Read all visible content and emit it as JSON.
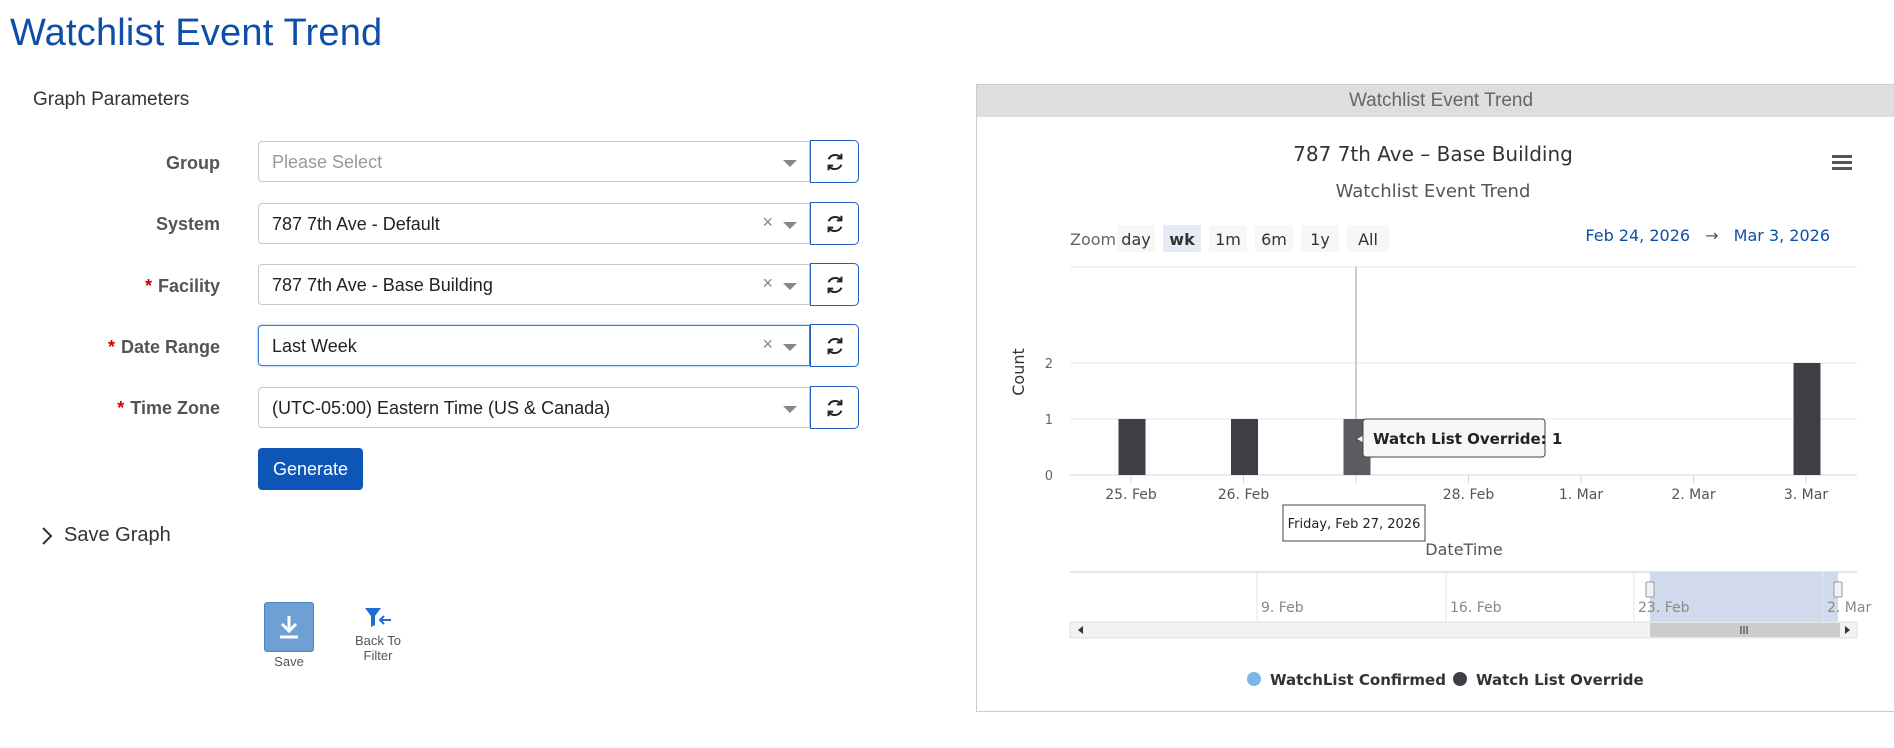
{
  "page": {
    "title": "Watchlist Event Trend"
  },
  "params": {
    "section_title": "Graph Parameters",
    "fields": [
      {
        "label": "Group",
        "required": false,
        "value": "Please Select",
        "placeholder": true,
        "clearable": false
      },
      {
        "label": "System",
        "required": false,
        "value": "787 7th Ave - Default",
        "placeholder": false,
        "clearable": true
      },
      {
        "label": "Facility",
        "required": true,
        "value": "787 7th Ave - Base Building",
        "placeholder": false,
        "clearable": true
      },
      {
        "label": "Date Range",
        "required": true,
        "value": "Last Week",
        "placeholder": false,
        "clearable": true
      },
      {
        "label": "Time Zone",
        "required": true,
        "value": "(UTC-05:00) Eastern Time (US & Canada)",
        "placeholder": false,
        "clearable": false
      }
    ],
    "required_mark": "*",
    "generate_label": "Generate"
  },
  "save_graph": {
    "label": "Save Graph"
  },
  "toolbar": {
    "save_label": "Save",
    "back_label_1": "Back To",
    "back_label_2": "Filter"
  },
  "chart_panel": {
    "header": "Watchlist Event Trend",
    "title": "787 7th Ave – Base Building",
    "subtitle": "Watchlist Event Trend",
    "zoom": {
      "label": "Zoom",
      "buttons": [
        "day",
        "wk",
        "1m",
        "6m",
        "1y",
        "All"
      ],
      "selected": "wk"
    },
    "range": {
      "from": "Feb 24, 2026",
      "arrow": "→",
      "to": "Mar 3, 2026"
    },
    "tooltip": {
      "series": "Watch List Override",
      "value": "1",
      "date": "Friday, Feb 27, 2026"
    },
    "navigator_labels": [
      "9. Feb",
      "16. Feb",
      "23. Feb",
      "2. Mar"
    ],
    "colors": {
      "override": "#3d3f45",
      "confirmed": "#7cb5ec",
      "accent": "#0d4fa8"
    }
  },
  "chart_data": {
    "type": "bar",
    "xlabel": "DateTime",
    "ylabel": "Count",
    "x_ticks": [
      "25. Feb",
      "26. Feb",
      "27. Feb",
      "28. Feb",
      "1. Mar",
      "2. Mar",
      "3. Mar"
    ],
    "y_ticks": [
      0,
      1,
      2
    ],
    "ylim": [
      0,
      2
    ],
    "grid": true,
    "legend_position": "bottom-center",
    "series": [
      {
        "name": "WatchList Confirmed",
        "color": "#7cb5ec",
        "points": []
      },
      {
        "name": "Watch List Override",
        "color": "#3d3f45",
        "points": [
          {
            "x": "25. Feb",
            "y": 1
          },
          {
            "x": "26. Feb",
            "y": 1
          },
          {
            "x": "27. Feb",
            "y": 1
          },
          {
            "x": "3. Mar",
            "y": 2
          }
        ]
      }
    ]
  }
}
